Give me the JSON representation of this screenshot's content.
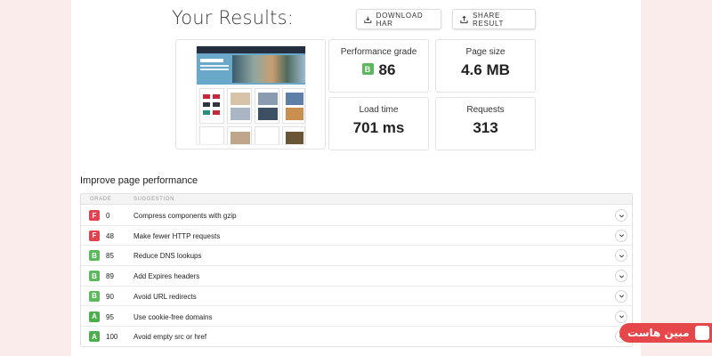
{
  "header": {
    "title": "Your Results:",
    "download_label": "DOWNLOAD HAR",
    "share_label": "SHARE RESULT"
  },
  "metrics": {
    "performance": {
      "label": "Performance grade",
      "grade": "B",
      "value": "86",
      "grade_color": "#5cb85c"
    },
    "page_size": {
      "label": "Page size",
      "value": "4.6 MB"
    },
    "load_time": {
      "label": "Load time",
      "value": "701 ms"
    },
    "requests": {
      "label": "Requests",
      "value": "313"
    }
  },
  "section": {
    "title": "Improve page performance",
    "col_grade": "GRADE",
    "col_suggestion": "SUGGESTION"
  },
  "rows": [
    {
      "grade": "F",
      "score": "0",
      "suggestion": "Compress components with gzip",
      "color": "#e2414f"
    },
    {
      "grade": "F",
      "score": "48",
      "suggestion": "Make fewer HTTP requests",
      "color": "#e2414f"
    },
    {
      "grade": "B",
      "score": "85",
      "suggestion": "Reduce DNS lookups",
      "color": "#5cb85c"
    },
    {
      "grade": "B",
      "score": "89",
      "suggestion": "Add Expires headers",
      "color": "#5cb85c"
    },
    {
      "grade": "B",
      "score": "90",
      "suggestion": "Avoid URL redirects",
      "color": "#5cb85c"
    },
    {
      "grade": "A",
      "score": "95",
      "suggestion": "Use cookie-free domains",
      "color": "#4cae4c"
    },
    {
      "grade": "A",
      "score": "100",
      "suggestion": "Avoid empty src or href",
      "color": "#4cae4c"
    }
  ],
  "watermark": {
    "text": "مبین هاست"
  }
}
